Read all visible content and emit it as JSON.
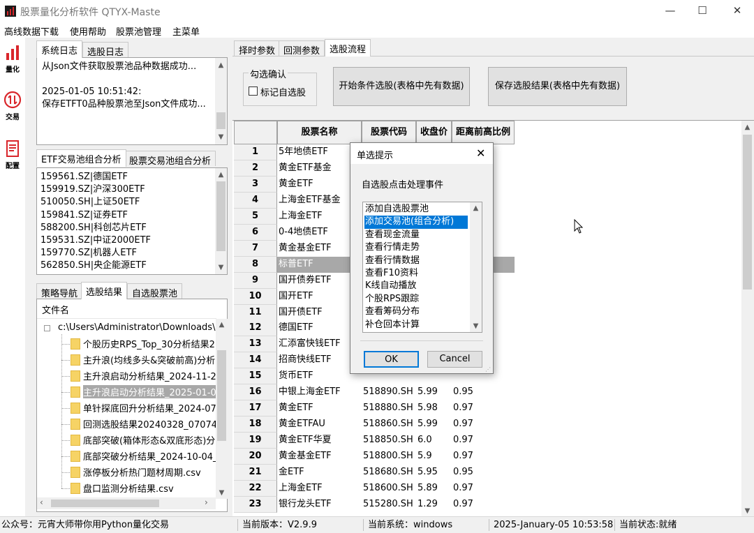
{
  "window": {
    "title": "股票量化分析软件 QTYX-Maste",
    "minimize": "—",
    "maximize": "☐",
    "close": "✕"
  },
  "menu": [
    "高线数据下载",
    "使用帮助",
    "股票池管理",
    "主菜单"
  ],
  "sidebar": [
    {
      "label": "量化",
      "icon": "bar-chart-icon"
    },
    {
      "label": "交易",
      "icon": "swap-arrows-icon"
    },
    {
      "label": "配置",
      "icon": "document-icon"
    }
  ],
  "log_panel": {
    "tabs": [
      "系统日志",
      "选股日志"
    ],
    "lines": [
      "从Json文件获取股票池品种数据成功...",
      "",
      "2025-01-05 10:51:42:",
      "保存ETFT0品种股票池至Json文件成功..."
    ]
  },
  "pool_panel": {
    "tabs": [
      "ETF交易池组合分析",
      "股票交易池组合分析"
    ],
    "items": [
      "159561.SZ|德国ETF",
      "159919.SZ|沪深300ETF",
      "510050.SH|上证50ETF",
      "159841.SZ|证券ETF",
      "588200.SH|科创芯片ETF",
      "159531.SZ|中证2000ETF",
      "159770.SZ|机器人ETF",
      "562850.SH|央企能源ETF"
    ]
  },
  "file_panel": {
    "tabs": [
      "策略导航",
      "选股结果",
      "自选股票池"
    ],
    "header": "文件名",
    "root": "c:\\Users\\Administrator\\Downloads\\",
    "files": [
      "个股历史RPS_Top_30分析结果2",
      "主升浪(均线多头&突破前高)分析",
      "主升浪启动分析结果_2024-11-2",
      "主升浪启动分析结果_2025-01-0",
      "单针探底回升分析结果_2024-07",
      "回测选股结果20240328_070749",
      "底部突破(箱体形态&双底形态)分",
      "底部突破分析结果_2024-10-04_",
      "涨停板分析热门题材周期.csv",
      "盘口监测分析结果.csv"
    ],
    "selected_index": 3
  },
  "right_tabs": [
    "择时参数",
    "回测参数",
    "选股流程"
  ],
  "selection": {
    "group_label": "勾选确认",
    "checkbox_label": "标记自选股",
    "checked": false,
    "start_button": "开始条件选股(表格中先有数据)",
    "save_button": "保存选股结果(表格中先有数据)"
  },
  "table": {
    "columns": [
      "股票名称",
      "股票代码",
      "收盘价",
      "距离前高比例"
    ],
    "rows": [
      {
        "num": "1",
        "name": "5年地债ETF",
        "code": "",
        "price": "",
        "ratio": ""
      },
      {
        "num": "2",
        "name": "黄金ETF基金",
        "code": "",
        "price": "",
        "ratio": ""
      },
      {
        "num": "3",
        "name": "黄金ETF",
        "code": "",
        "price": "",
        "ratio": ""
      },
      {
        "num": "4",
        "name": "上海金ETF基金",
        "code": "",
        "price": "",
        "ratio": ""
      },
      {
        "num": "5",
        "name": "上海金ETF",
        "code": "",
        "price": "",
        "ratio": ""
      },
      {
        "num": "6",
        "name": "0-4地债ETF",
        "code": "",
        "price": "",
        "ratio": ""
      },
      {
        "num": "7",
        "name": "黄金基金ETF",
        "code": "",
        "price": "",
        "ratio": ""
      },
      {
        "num": "8",
        "name": "标普ETF",
        "code": "",
        "price": "",
        "ratio": ""
      },
      {
        "num": "9",
        "name": "国开债券ETF",
        "code": "",
        "price": "",
        "ratio": ""
      },
      {
        "num": "10",
        "name": "国开ETF",
        "code": "",
        "price": "",
        "ratio": ""
      },
      {
        "num": "11",
        "name": "国开债ETF",
        "code": "",
        "price": "",
        "ratio": ""
      },
      {
        "num": "12",
        "name": "德国ETF",
        "code": "",
        "price": "",
        "ratio": ""
      },
      {
        "num": "13",
        "name": "汇添富快钱ETF",
        "code": "",
        "price": "",
        "ratio": ""
      },
      {
        "num": "14",
        "name": "招商快线ETF",
        "code": "",
        "price": "",
        "ratio": ""
      },
      {
        "num": "15",
        "name": "货币ETF",
        "code": "",
        "price": "",
        "ratio": ""
      },
      {
        "num": "16",
        "name": "中银上海金ETF",
        "code": "518890.SH",
        "price": "5.99",
        "ratio": "0.95"
      },
      {
        "num": "17",
        "name": "黄金ETF",
        "code": "518880.SH",
        "price": "5.98",
        "ratio": "0.97"
      },
      {
        "num": "18",
        "name": "黄金ETFAU",
        "code": "518860.SH",
        "price": "5.99",
        "ratio": "0.97"
      },
      {
        "num": "19",
        "name": "黄金ETF华夏",
        "code": "518850.SH",
        "price": "6.0",
        "ratio": "0.97"
      },
      {
        "num": "20",
        "name": "黄金基金ETF",
        "code": "518800.SH",
        "price": "5.9",
        "ratio": "0.97"
      },
      {
        "num": "21",
        "name": "金ETF",
        "code": "518680.SH",
        "price": "5.95",
        "ratio": "0.95"
      },
      {
        "num": "22",
        "name": "上海金ETF",
        "code": "518600.SH",
        "price": "5.89",
        "ratio": "0.97"
      },
      {
        "num": "23",
        "name": "银行龙头ETF",
        "code": "515280.SH",
        "price": "1.29",
        "ratio": "0.97"
      }
    ],
    "highlight_index": 7
  },
  "dialog": {
    "title": "单选提示",
    "message": "自选股点击处理事件",
    "options": [
      "添加自选股票池",
      "添加交易池(组合分析)",
      "查看现金流量",
      "查看行情走势",
      "查看行情数据",
      "查看F10资料",
      "K线自动播放",
      "个股RPS跟踪",
      "查看筹码分布",
      "补仓回本计算"
    ],
    "selected_index": 1,
    "ok": "OK",
    "cancel": "Cancel"
  },
  "status_bar": {
    "wechat": "公众号：元宵大师带你用Python量化交易",
    "version": "当前版本：V2.9.9",
    "system": "当前系统：windows",
    "datetime": "2025-January-05 10:53:58",
    "state": "当前状态:就绪"
  },
  "colors": {
    "accent": "#0078d7",
    "icon_red": "#d9262b",
    "highlight_row": "#a8a8a8"
  }
}
